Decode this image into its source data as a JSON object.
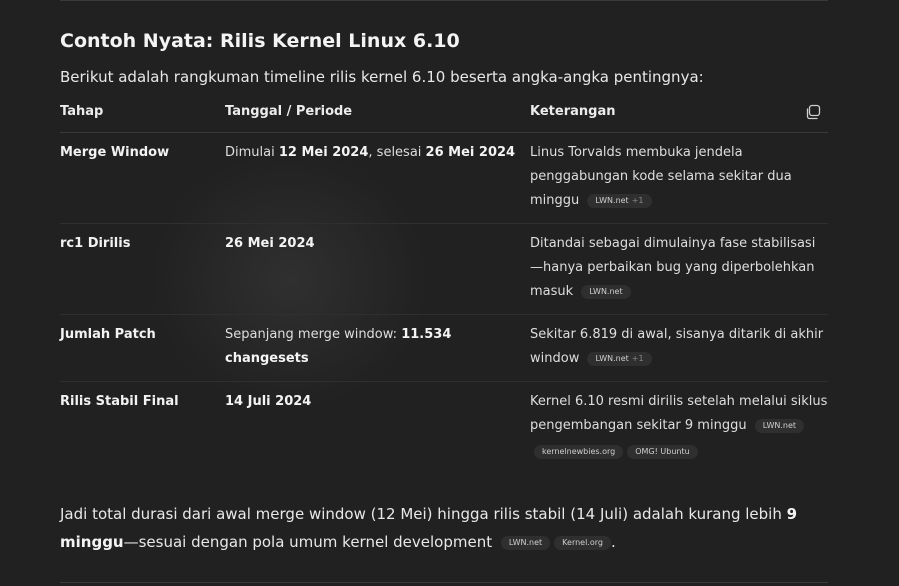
{
  "heading": "Contoh Nyata: Rilis Kernel Linux 6.10",
  "intro": "Berikut adalah rangkuman timeline rilis kernel 6.10 beserta angka-angka pentingnya:",
  "table": {
    "headers": [
      "Tahap",
      "Tanggal / Periode",
      "Keterangan"
    ],
    "copy_icon": "copy-icon",
    "rows": [
      {
        "tahap": "Merge Window",
        "tanggal": {
          "pre": "Dimulai ",
          "b1": "12 Mei 2024",
          "mid": ", selesai ",
          "b2": "26 Mei 2024"
        },
        "keterangan": "Linus Torvalds membuka jendela penggabungan kode selama sekitar dua minggu",
        "cite": {
          "label": "LWN.net",
          "extra": "+1"
        }
      },
      {
        "tahap": "rc1 Dirilis",
        "tanggal": {
          "b1": "26 Mei 2024"
        },
        "keterangan": "Ditandai sebagai dimulainya fase stabilisasi—hanya perbaikan bug yang diperbolehkan masuk",
        "cite": {
          "label": "LWN.net"
        }
      },
      {
        "tahap": "Jumlah Patch",
        "tanggal": {
          "pre": "Sepanjang merge window: ",
          "b1": "11.534 changesets"
        },
        "keterangan": "Sekitar 6.819 di awal, sisanya ditarik di akhir window",
        "cite": {
          "label": "LWN.net",
          "extra": "+1"
        }
      },
      {
        "tahap": "Rilis Stabil Final",
        "tanggal": {
          "b1": "14 Juli 2024"
        },
        "keterangan": "Kernel 6.10 resmi dirilis setelah melalui siklus pengembangan sekitar 9 minggu",
        "cites": [
          "LWN.net",
          "kernelnewbies.org",
          "OMG! Ubuntu"
        ]
      }
    ]
  },
  "summary": {
    "text1": "Jadi total durasi dari awal merge window (12 Mei) hingga rilis stabil (14 Juli) adalah kurang lebih ",
    "bold": "9 minggu",
    "text2": "—sesuai dengan pola umum kernel development",
    "cites": [
      "LWN.net",
      "Kernel.org"
    ],
    "end": "."
  }
}
